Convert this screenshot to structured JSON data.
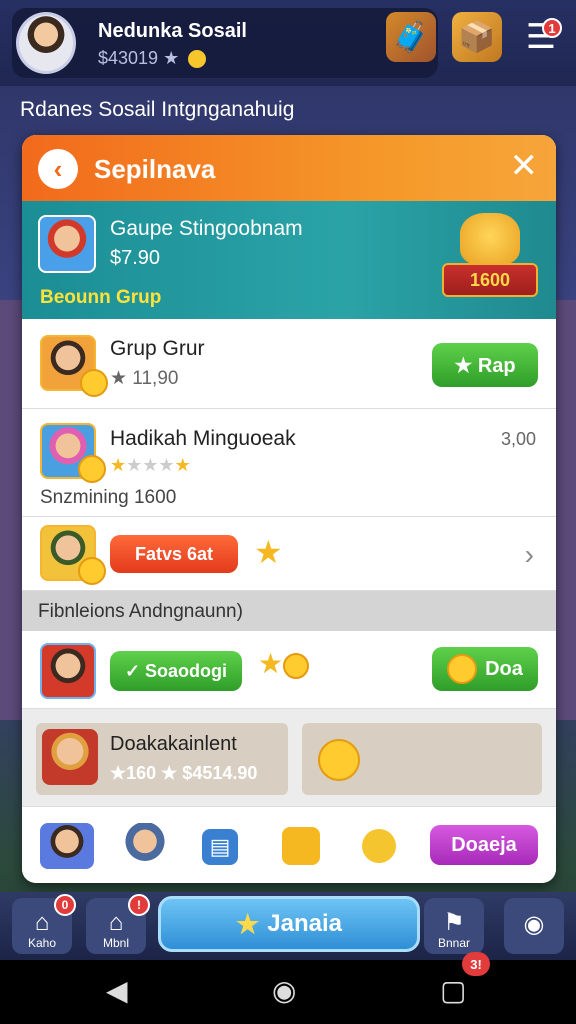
{
  "profile": {
    "name": "Nedunka Sosail",
    "score": "$43019 ★"
  },
  "top_icons": {
    "chest": "chest-icon",
    "box": "box-icon",
    "menu": "menu-icon",
    "menu_badge": "1"
  },
  "subtitle": "Rdanes Sosail Intgnganahuig",
  "panel": {
    "title": "Sepilnava",
    "back": "‹",
    "close": "✕"
  },
  "featured": {
    "name": "Gaupe Stingoobnam",
    "price": "$7.90",
    "group": "Beounn Grup",
    "trophy_value": "1600"
  },
  "rows": [
    {
      "title": "Grup Grur",
      "sub": "★ 11,90",
      "button": "★ Rap"
    },
    {
      "title": "Hadikah Minguoeak",
      "value": "3,00",
      "sub": "Snzmining 1600",
      "stars_filled": 1,
      "stars_total": 5
    },
    {
      "button": "Fatvs 6at",
      "star": "★"
    }
  ],
  "section": {
    "label": "Fibnleions Andngnaunn)"
  },
  "row4": {
    "button_left": "✓ Soaodogi",
    "button_right": "Doa"
  },
  "row5": {
    "title": "Doakakainlent",
    "sub": "★160 ★ $4514.90"
  },
  "row6": {
    "button": "Doaeja"
  },
  "nav": {
    "home": "Kaho",
    "home_badge": "0",
    "mon": "Mbnl",
    "mon_badge": "!",
    "center": "Janaia",
    "right": "Bnnar"
  },
  "system": {
    "back": "◀",
    "home": "◉",
    "recent": "▢",
    "badge": "3!"
  }
}
